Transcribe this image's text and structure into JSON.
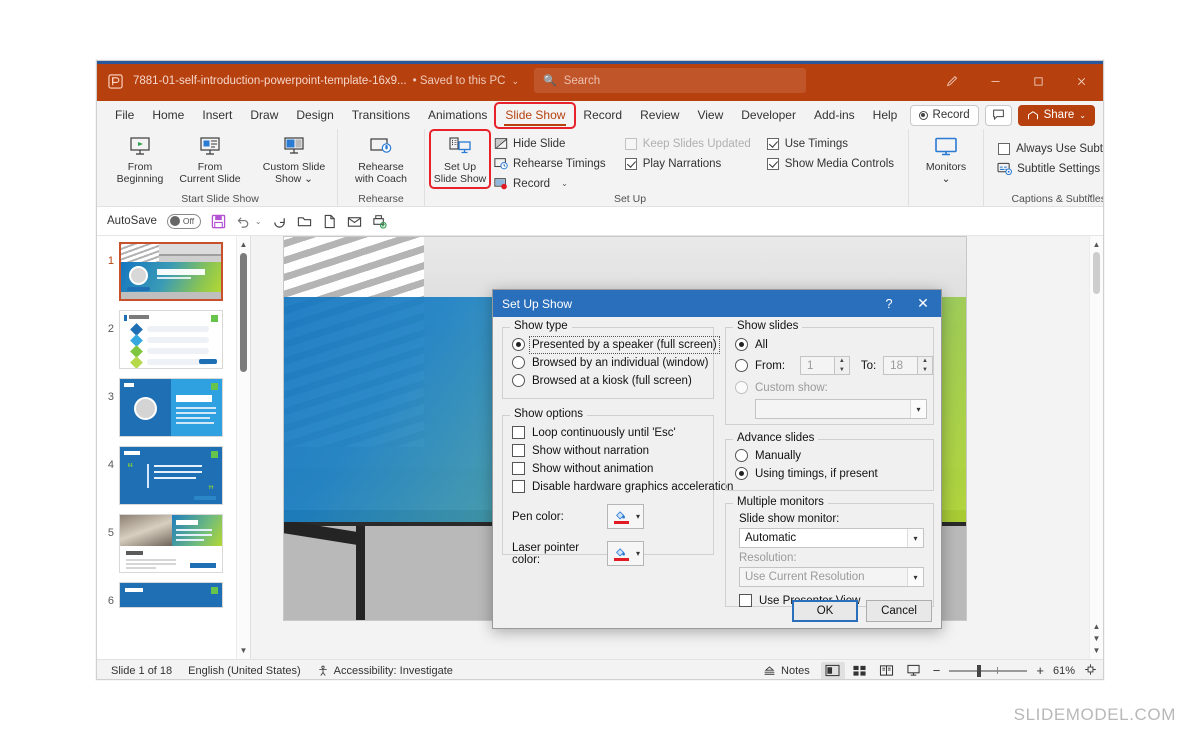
{
  "window": {
    "title": "7881-01-self-introduction-powerpoint-template-16x9...",
    "saved_status": "• Saved to this PC",
    "saved_chevron": "⌄",
    "search_placeholder": "Search",
    "app_icon": "powerpoint-icon",
    "buttons": {
      "pen": "pen-icon",
      "minimize": "minimize-icon",
      "maximize": "maximize-icon",
      "close": "close-icon"
    }
  },
  "tabs": {
    "items": [
      {
        "label": "File"
      },
      {
        "label": "Home"
      },
      {
        "label": "Insert"
      },
      {
        "label": "Draw"
      },
      {
        "label": "Design"
      },
      {
        "label": "Transitions"
      },
      {
        "label": "Animations"
      },
      {
        "label": "Slide Show"
      },
      {
        "label": "Record"
      },
      {
        "label": "Review"
      },
      {
        "label": "View"
      },
      {
        "label": "Developer"
      },
      {
        "label": "Add-ins"
      },
      {
        "label": "Help"
      }
    ],
    "active": "Slide Show",
    "right": {
      "record": "Record",
      "comment": "comment-icon",
      "share": "Share",
      "share_chevron": "⌄"
    }
  },
  "ribbon": {
    "groups": [
      {
        "name": "Start Slide Show",
        "label": "Start Slide Show",
        "buttons": [
          {
            "label_line1": "From",
            "label_line2": "Beginning",
            "icon": "from-beginning-icon"
          },
          {
            "label_line1": "From",
            "label_line2": "Current Slide",
            "icon": "from-current-slide-icon"
          },
          {
            "label_line1": "Custom Slide",
            "label_line2": "Show ⌄",
            "icon": "custom-slide-show-icon"
          }
        ]
      },
      {
        "name": "Rehearse",
        "label": "Rehearse",
        "buttons": [
          {
            "label_line1": "Rehearse",
            "label_line2": "with Coach",
            "icon": "rehearse-with-coach-icon"
          }
        ]
      },
      {
        "name": "Set Up",
        "label": "Set Up",
        "setup_button": {
          "label_line1": "Set Up",
          "label_line2": "Slide Show",
          "icon": "set-up-slide-show-icon"
        },
        "small_buttons": [
          {
            "label": "Hide Slide",
            "icon": "hide-slide-icon",
            "disabled": false
          },
          {
            "label": "Rehearse Timings",
            "icon": "rehearse-timings-icon",
            "disabled": false
          },
          {
            "label": "Record",
            "icon": "record-icon",
            "chevron": "⌄",
            "disabled": false
          }
        ],
        "checks": [
          {
            "label": "Keep Slides Updated",
            "checked": false,
            "disabled": true
          },
          {
            "label": "Play Narrations",
            "checked": true,
            "disabled": false
          },
          {
            "label": "Use Timings",
            "checked": true,
            "disabled": false
          },
          {
            "label": "Show Media Controls",
            "checked": true,
            "disabled": false
          }
        ]
      },
      {
        "name": "Monitors",
        "label": "",
        "buttons": [
          {
            "label_line1": "Monitors",
            "label_line2": "⌄",
            "icon": "monitor-icon"
          }
        ]
      },
      {
        "name": "Captions & Subtitles",
        "label": "Captions & Subtitles",
        "checks": [
          {
            "label": "Always Use Subtitles",
            "checked": false,
            "disabled": false
          }
        ],
        "small_buttons": [
          {
            "label": "Subtitle Settings",
            "icon": "subtitle-settings-icon",
            "chevron": "⌄"
          }
        ]
      }
    ],
    "collapse_icon": "⌄"
  },
  "quick_access": {
    "autosave_label": "AutoSave",
    "autosave_state": "Off",
    "items": [
      {
        "icon": "save-icon"
      },
      {
        "icon": "undo-icon"
      },
      {
        "icon": "redo-icon"
      },
      {
        "icon": "open-icon"
      },
      {
        "icon": "new-icon"
      },
      {
        "icon": "email-icon"
      },
      {
        "icon": "print-preview-icon"
      }
    ]
  },
  "thumbnails": {
    "slides": [
      {
        "number": "1",
        "selected": true
      },
      {
        "number": "2",
        "selected": false
      },
      {
        "number": "3",
        "selected": false
      },
      {
        "number": "4",
        "selected": false
      },
      {
        "number": "5",
        "selected": false
      },
      {
        "number": "6",
        "selected": false
      }
    ]
  },
  "slide_canvas": {
    "title_text_visible": "on"
  },
  "status_bar": {
    "slide_indicator": "Slide 1 of 18",
    "language": "English (United States)",
    "accessibility": "Accessibility: Investigate",
    "notes_label": "Notes",
    "views": [
      {
        "name": "normal-view",
        "icon": "normal-view-icon",
        "active": true
      },
      {
        "name": "slide-sorter-view",
        "icon": "slide-sorter-icon",
        "active": false
      },
      {
        "name": "reading-view",
        "icon": "reading-view-icon",
        "active": false
      },
      {
        "name": "slide-show-view",
        "icon": "slide-show-icon",
        "active": false
      }
    ],
    "zoom_out": "−",
    "zoom_in": "+",
    "zoom_level": "61%",
    "fit_icon": "fit-slide-icon"
  },
  "dialog": {
    "title": "Set Up Show",
    "help_btn": "?",
    "close_btn": "✕",
    "show_type": {
      "legend": "Show type",
      "options": [
        {
          "label": "Presented by a speaker (full screen)",
          "selected": true,
          "focused": true,
          "accel": "P"
        },
        {
          "label": "Browsed by an individual (window)",
          "selected": false,
          "accel": "B"
        },
        {
          "label": "Browsed at a kiosk (full screen)",
          "selected": false,
          "accel": "k"
        }
      ]
    },
    "show_options": {
      "legend": "Show options",
      "checks": [
        {
          "label": "Loop continuously until 'Esc'",
          "checked": false
        },
        {
          "label": "Show without narration",
          "checked": false
        },
        {
          "label": "Show without animation",
          "checked": false
        },
        {
          "label": "Disable hardware graphics acceleration",
          "checked": false
        }
      ],
      "pen_color_label": "Pen color:",
      "laser_color_label": "Laser pointer color:"
    },
    "show_slides": {
      "legend": "Show slides",
      "all_label": "All",
      "all_selected": true,
      "from_label": "From:",
      "from_value": "1",
      "to_label": "To:",
      "to_value": "18",
      "custom_label": "Custom show:",
      "custom_value": "",
      "custom_disabled": true
    },
    "advance_slides": {
      "legend": "Advance slides",
      "options": [
        {
          "label": "Manually",
          "selected": false
        },
        {
          "label": "Using timings, if present",
          "selected": true
        }
      ]
    },
    "multiple_monitors": {
      "legend": "Multiple monitors",
      "monitor_label": "Slide show monitor:",
      "monitor_value": "Automatic",
      "resolution_label": "Resolution:",
      "resolution_value": "Use Current Resolution",
      "presenter_view_label": "Use Presenter View",
      "presenter_view_checked": false
    },
    "ok_label": "OK",
    "cancel_label": "Cancel"
  },
  "watermark": "SLIDEMODEL.COM",
  "colors": {
    "titlebar": "#b7410e",
    "dialog_title": "#2a6fbb",
    "accent_red": "#e8212a",
    "slide_gradient_start": "#1475c0",
    "slide_gradient_end": "#b3d833"
  }
}
